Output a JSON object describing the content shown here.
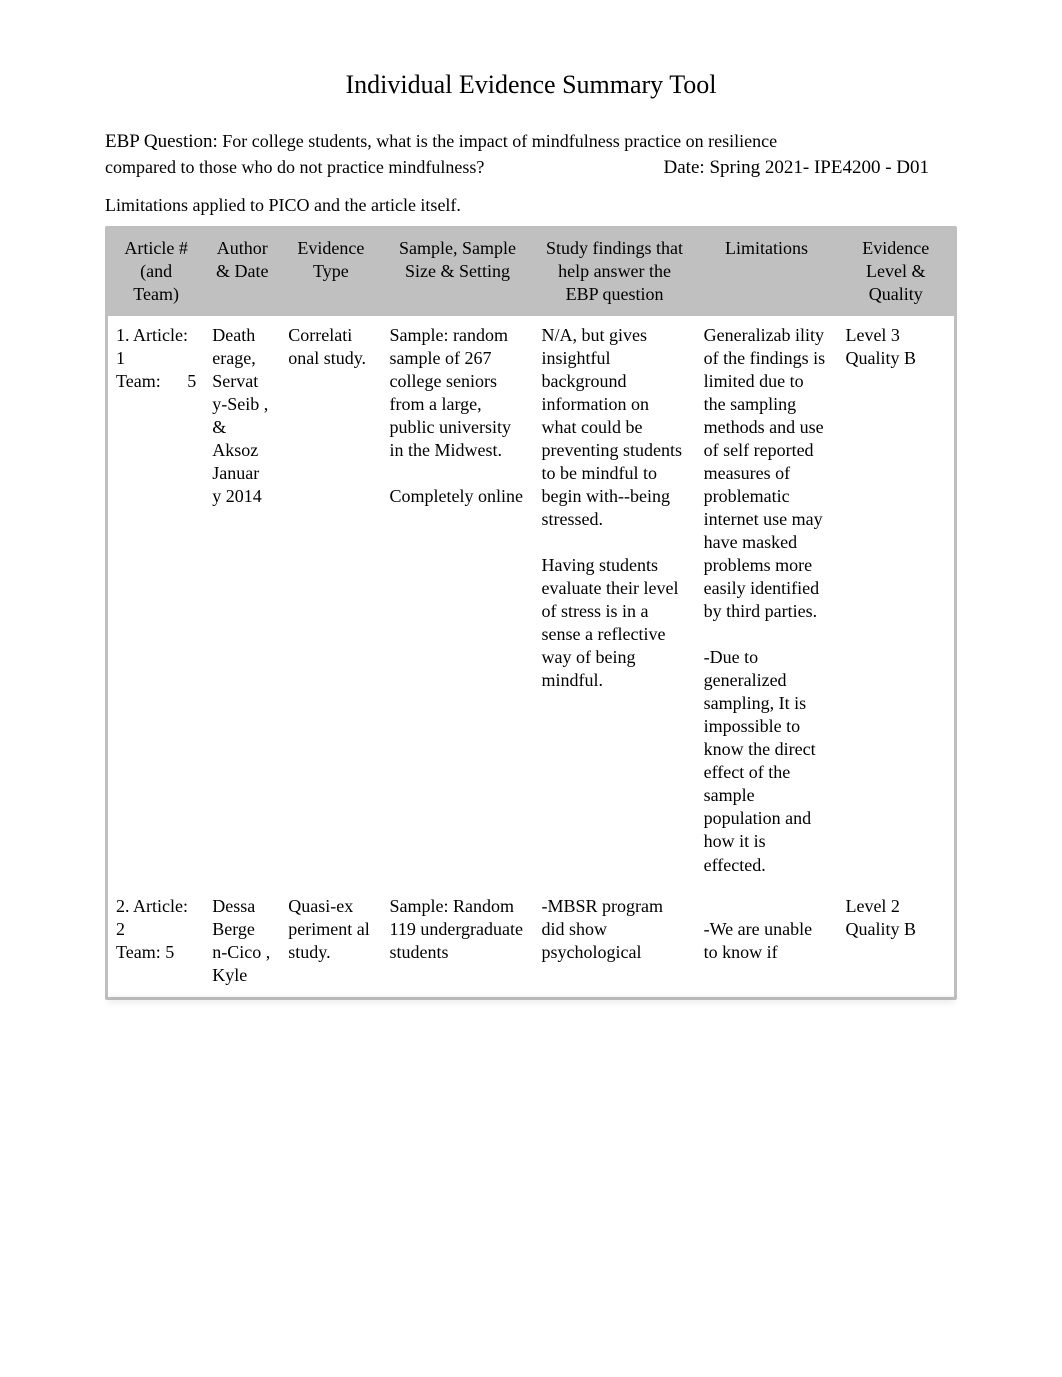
{
  "title": "Individual Evidence Summary Tool",
  "ebp_label": "EBP Question:",
  "ebp_text_line1": " For college students, what is the impact of mindfulness practice on resilience",
  "ebp_text_line2": "compared to those who do not practice mindfulness?",
  "date_label": "Date: ",
  "date_value": "Spring 2021- IPE4200 - D01",
  "limitations_note": "Limitations applied to PICO and the article itself.",
  "headers": {
    "article": "Article # (and Team)",
    "author": "Author & Date",
    "evtype": "Evidence Type",
    "sample": "Sample, Sample Size & Setting",
    "findings": "Study findings that help answer the EBP question",
    "limits": "Limitations",
    "level": "Evidence Level & Quality"
  },
  "rows": [
    {
      "article_line1": "1. Article:",
      "article_line2": "1",
      "article_team_label": "Team:",
      "article_team_num": "5",
      "author": "Death erage, Servat y-Seib , & Aksoz Januar y 2014",
      "evtype": "Correlati onal study.",
      "sample": "Sample: random sample of 267 college seniors from a large, public university in the Midwest.\n\nCompletely online",
      "findings": "N/A, but gives insightful background information on what could be preventing students to be mindful to begin with--being stressed.\n\nHaving students evaluate their level of stress is in a sense a reflective way of being mindful.",
      "limits": "Generalizab ility of the findings is limited due to the sampling methods and use of self reported measures of problematic internet use may have masked problems more easily identified by third parties.\n\n-Due to generalized sampling, It is impossible to know the direct effect of the sample population and how it is effected.",
      "level": "Level 3\nQuality B"
    },
    {
      "article_line1": "2. Article:",
      "article_line2": "2",
      "article_team_label": "Team: 5",
      "article_team_num": "",
      "author": "Dessa Berge n-Cico , Kyle",
      "evtype": "Quasi-ex periment al study.",
      "sample": "Sample: Random 119 undergraduate students",
      "findings": "-MBSR program did show psychological",
      "limits": "\n-We are unable to know if",
      "level": "Level 2\nQuality B"
    }
  ]
}
